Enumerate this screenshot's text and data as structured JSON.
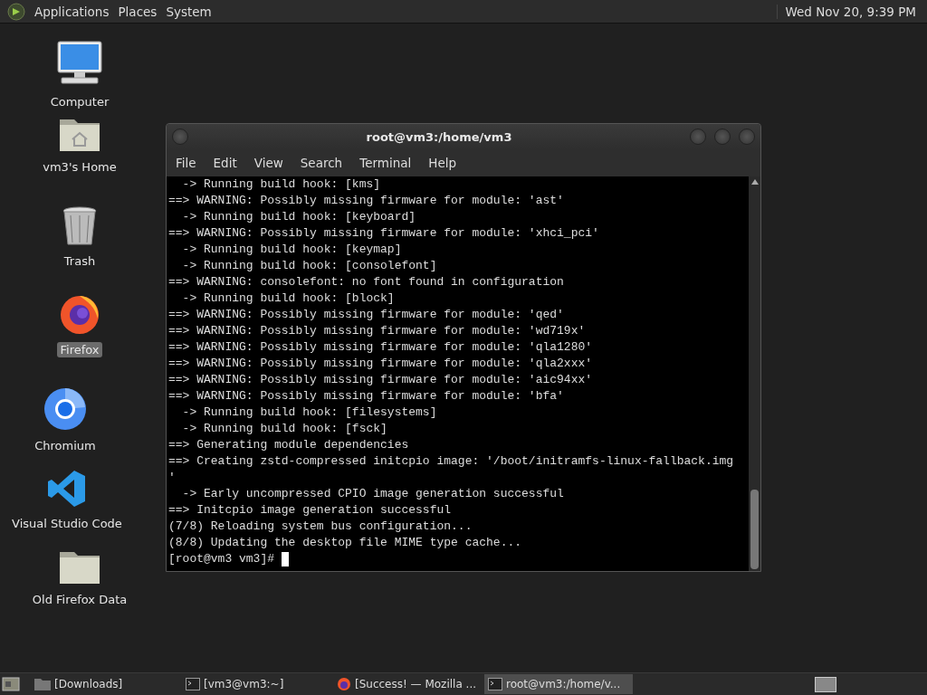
{
  "top_panel": {
    "menus": [
      "Applications",
      "Places",
      "System"
    ],
    "clock": "Wed Nov 20,  9:39 PM"
  },
  "desktop_icons": [
    {
      "kind": "computer",
      "label": "Computer",
      "selected": false
    },
    {
      "kind": "home",
      "label": "vm3's Home",
      "selected": false
    },
    {
      "kind": "trash",
      "label": "Trash",
      "selected": false
    },
    {
      "kind": "firefox",
      "label": "Firefox",
      "selected": true
    },
    {
      "kind": "chromium",
      "label": "Chromium",
      "selected": false
    },
    {
      "kind": "vscode",
      "label": "Visual Studio Code",
      "selected": false
    },
    {
      "kind": "folder",
      "label": "Old Firefox Data",
      "selected": false
    }
  ],
  "terminal": {
    "title": "root@vm3:/home/vm3",
    "menu": [
      "File",
      "Edit",
      "View",
      "Search",
      "Terminal",
      "Help"
    ],
    "lines": [
      "  -> Running build hook: [kms]",
      "==> WARNING: Possibly missing firmware for module: 'ast'",
      "  -> Running build hook: [keyboard]",
      "==> WARNING: Possibly missing firmware for module: 'xhci_pci'",
      "  -> Running build hook: [keymap]",
      "  -> Running build hook: [consolefont]",
      "==> WARNING: consolefont: no font found in configuration",
      "  -> Running build hook: [block]",
      "==> WARNING: Possibly missing firmware for module: 'qed'",
      "==> WARNING: Possibly missing firmware for module: 'wd719x'",
      "==> WARNING: Possibly missing firmware for module: 'qla1280'",
      "==> WARNING: Possibly missing firmware for module: 'qla2xxx'",
      "==> WARNING: Possibly missing firmware for module: 'aic94xx'",
      "==> WARNING: Possibly missing firmware for module: 'bfa'",
      "  -> Running build hook: [filesystems]",
      "  -> Running build hook: [fsck]",
      "==> Generating module dependencies",
      "==> Creating zstd-compressed initcpio image: '/boot/initramfs-linux-fallback.img",
      "'",
      "  -> Early uncompressed CPIO image generation successful",
      "==> Initcpio image generation successful",
      "(7/8) Reloading system bus configuration...",
      "(8/8) Updating the desktop file MIME type cache..."
    ],
    "prompt": "[root@vm3 vm3]# "
  },
  "taskbar": {
    "items": [
      {
        "kind": "folder",
        "label": "[Downloads]",
        "selected": false
      },
      {
        "kind": "terminal",
        "label": "[vm3@vm3:~]",
        "selected": false
      },
      {
        "kind": "firefox",
        "label": "[Success! — Mozilla ...",
        "selected": false
      },
      {
        "kind": "terminal",
        "label": "root@vm3:/home/v...",
        "selected": true
      }
    ]
  }
}
